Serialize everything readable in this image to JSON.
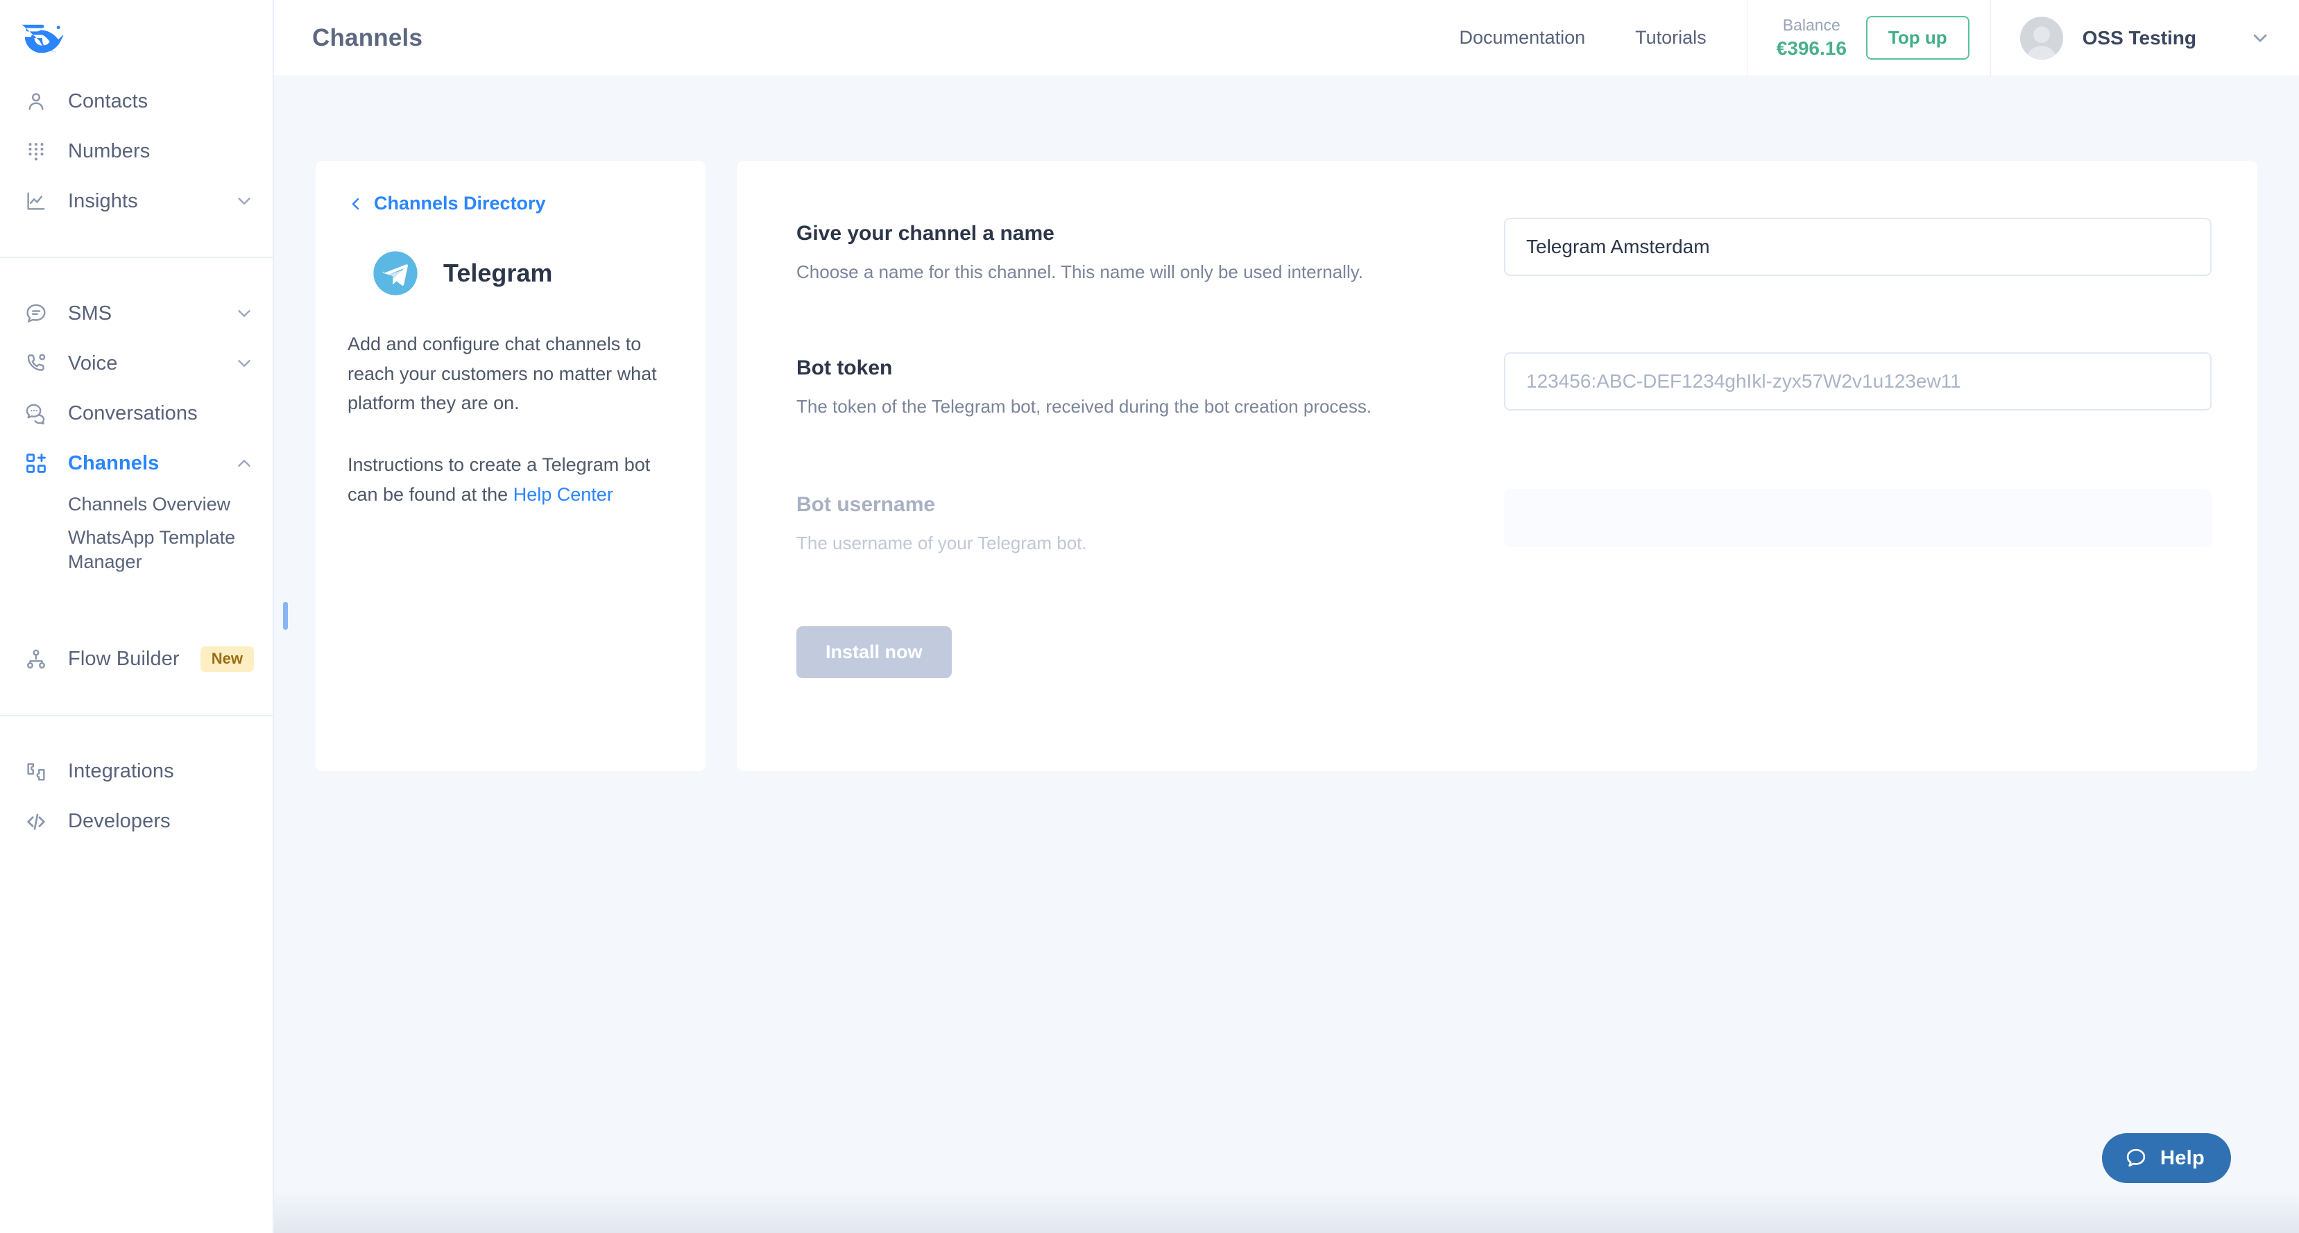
{
  "brand": {
    "logo_name": "messagebird-logo",
    "accent": "#2a85ff"
  },
  "sidebar": {
    "primary": [
      {
        "label": "Contacts",
        "icon": "contact-person-icon",
        "expandable": false
      },
      {
        "label": "Numbers",
        "icon": "numbers-keypad-icon",
        "expandable": false
      },
      {
        "label": "Insights",
        "icon": "insights-chart-icon",
        "expandable": true
      }
    ],
    "secondary": [
      {
        "label": "SMS",
        "icon": "sms-bubble-icon",
        "expandable": true
      },
      {
        "label": "Voice",
        "icon": "voice-phone-icon",
        "expandable": true
      },
      {
        "label": "Conversations",
        "icon": "conversations-bubbles-icon",
        "expandable": false
      },
      {
        "label": "Channels",
        "icon": "channels-grid-plus-icon",
        "expandable": true,
        "active": true
      }
    ],
    "channels_subitems": [
      {
        "label": "Channels Overview"
      },
      {
        "label": "WhatsApp Template Manager"
      }
    ],
    "flow_builder": {
      "label": "Flow Builder",
      "icon": "flow-nodes-icon",
      "badge": "New"
    },
    "footer": [
      {
        "label": "Integrations",
        "icon": "integrations-puzzle-icon"
      },
      {
        "label": "Developers",
        "icon": "developers-code-icon"
      }
    ]
  },
  "topbar": {
    "title": "Channels",
    "links": [
      {
        "label": "Documentation"
      },
      {
        "label": "Tutorials"
      }
    ],
    "balance_label": "Balance",
    "balance_amount": "€396.16",
    "topup_label": "Top up",
    "user_name": "OSS Testing",
    "balance_color": "#4ab08a"
  },
  "info_card": {
    "back_label": "Channels Directory",
    "channel_name": "Telegram",
    "logo_name": "telegram-logo",
    "paragraph_1": "Add and configure chat channels to reach your customers no matter what platform they are on.",
    "paragraph_2_prefix": "Instructions to create a Telegram bot can be found at the ",
    "paragraph_2_link": "Help Center"
  },
  "form": {
    "fields": [
      {
        "title": "Give your channel a name",
        "description": "Choose a name for this channel. This name will only be used internally.",
        "value": "Telegram Amsterdam",
        "placeholder": "",
        "disabled": false
      },
      {
        "title": "Bot token",
        "description": "The token of the Telegram bot, received during the bot creation process.",
        "value": "",
        "placeholder": "123456:ABC-DEF1234ghIkl-zyx57W2v1u123ew11",
        "disabled": false
      },
      {
        "title": "Bot username",
        "description": "The username of your Telegram bot.",
        "value": "",
        "placeholder": "",
        "disabled": true
      }
    ],
    "submit_label": "Install now",
    "submit_disabled": true
  },
  "help_widget": {
    "label": "Help",
    "icon": "help-bubble-icon",
    "color": "#3071b3"
  }
}
